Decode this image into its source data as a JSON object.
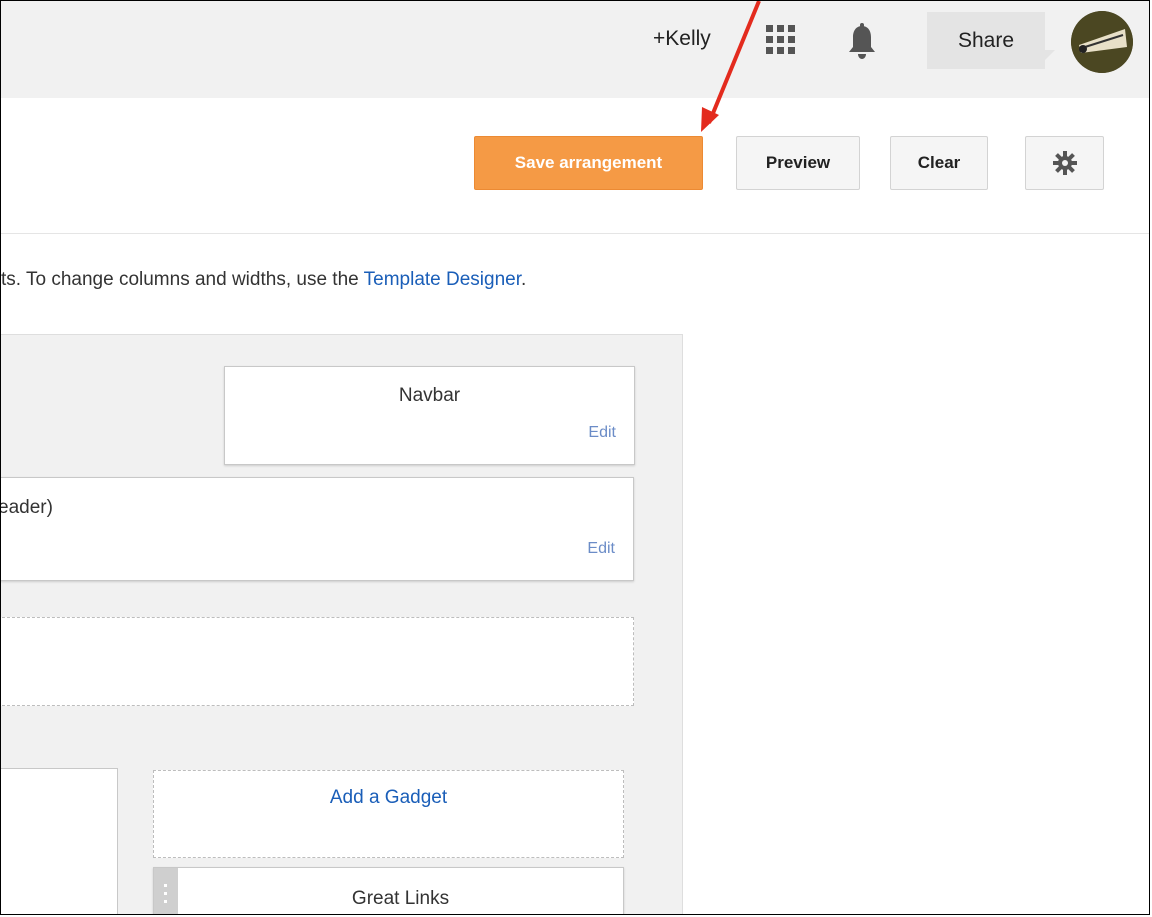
{
  "topbar": {
    "account_label": "+Kelly",
    "apps_icon": "apps-grid-icon",
    "notifications_icon": "bell-icon",
    "share_label": "Share",
    "avatar_icon": "profile-avatar"
  },
  "toolbar": {
    "save_label": "Save arrangement",
    "preview_label": "Preview",
    "clear_label": "Clear",
    "settings_icon": "gear-icon",
    "save_color": "#f59a45"
  },
  "instruction": {
    "text": "ts. To change columns and widths, use the ",
    "link_text": "Template Designer",
    "trailing": "."
  },
  "layout": {
    "navbar": {
      "title": "Navbar",
      "edit_label": "Edit"
    },
    "header": {
      "title": "eader)",
      "edit_label": "Edit"
    },
    "add_gadget_label": "Add a Gadget",
    "great_links_title": "Great Links"
  }
}
